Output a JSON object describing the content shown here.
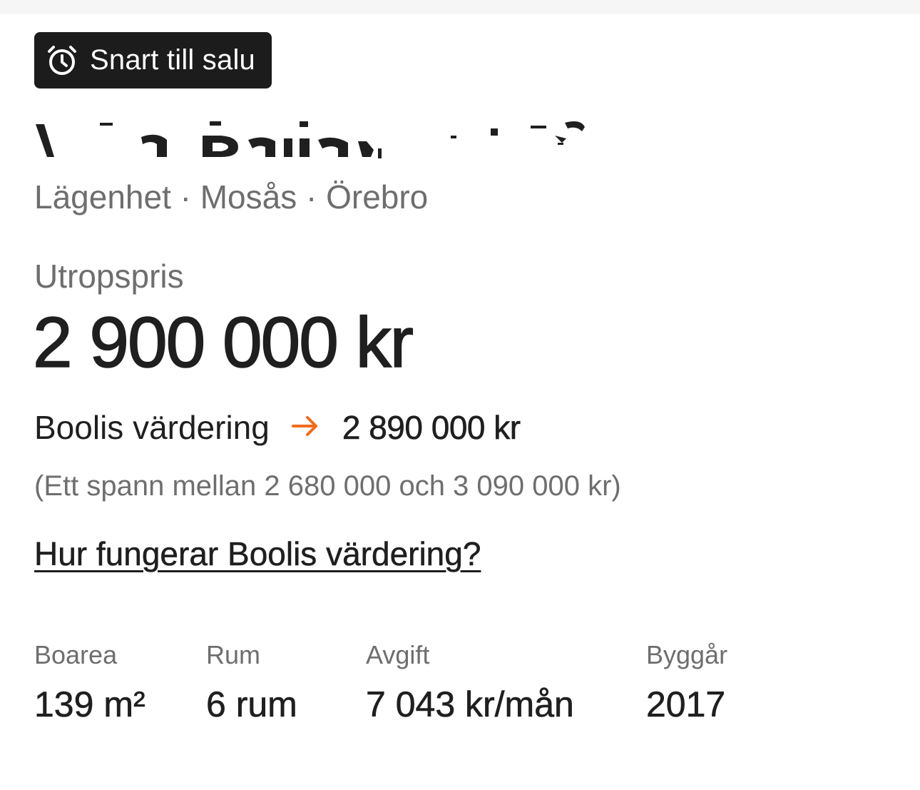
{
  "badge": {
    "icon": "alarm-clock-icon",
    "label": "Snart till salu",
    "background": "#1c1c1c"
  },
  "listing": {
    "subtitle": "Lägenhet · Mosås · Örebro"
  },
  "price": {
    "label": "Utropspris",
    "value": "2 900 000 kr"
  },
  "valuation": {
    "label": "Boolis värdering",
    "arrow_icon": "arrow-right-icon",
    "arrow_color": "#f26b1d",
    "value": "2 890 000 kr",
    "range": "(Ett spann mellan 2 680 000 och 3 090 000 kr)",
    "how_link": "Hur fungerar Boolis värdering?"
  },
  "facts": [
    {
      "label": "Boarea",
      "value": "139 m²"
    },
    {
      "label": "Rum",
      "value": "6 rum"
    },
    {
      "label": "Avgift",
      "value": "7 043 kr/mån"
    },
    {
      "label": "Byggår",
      "value": "2017"
    }
  ]
}
